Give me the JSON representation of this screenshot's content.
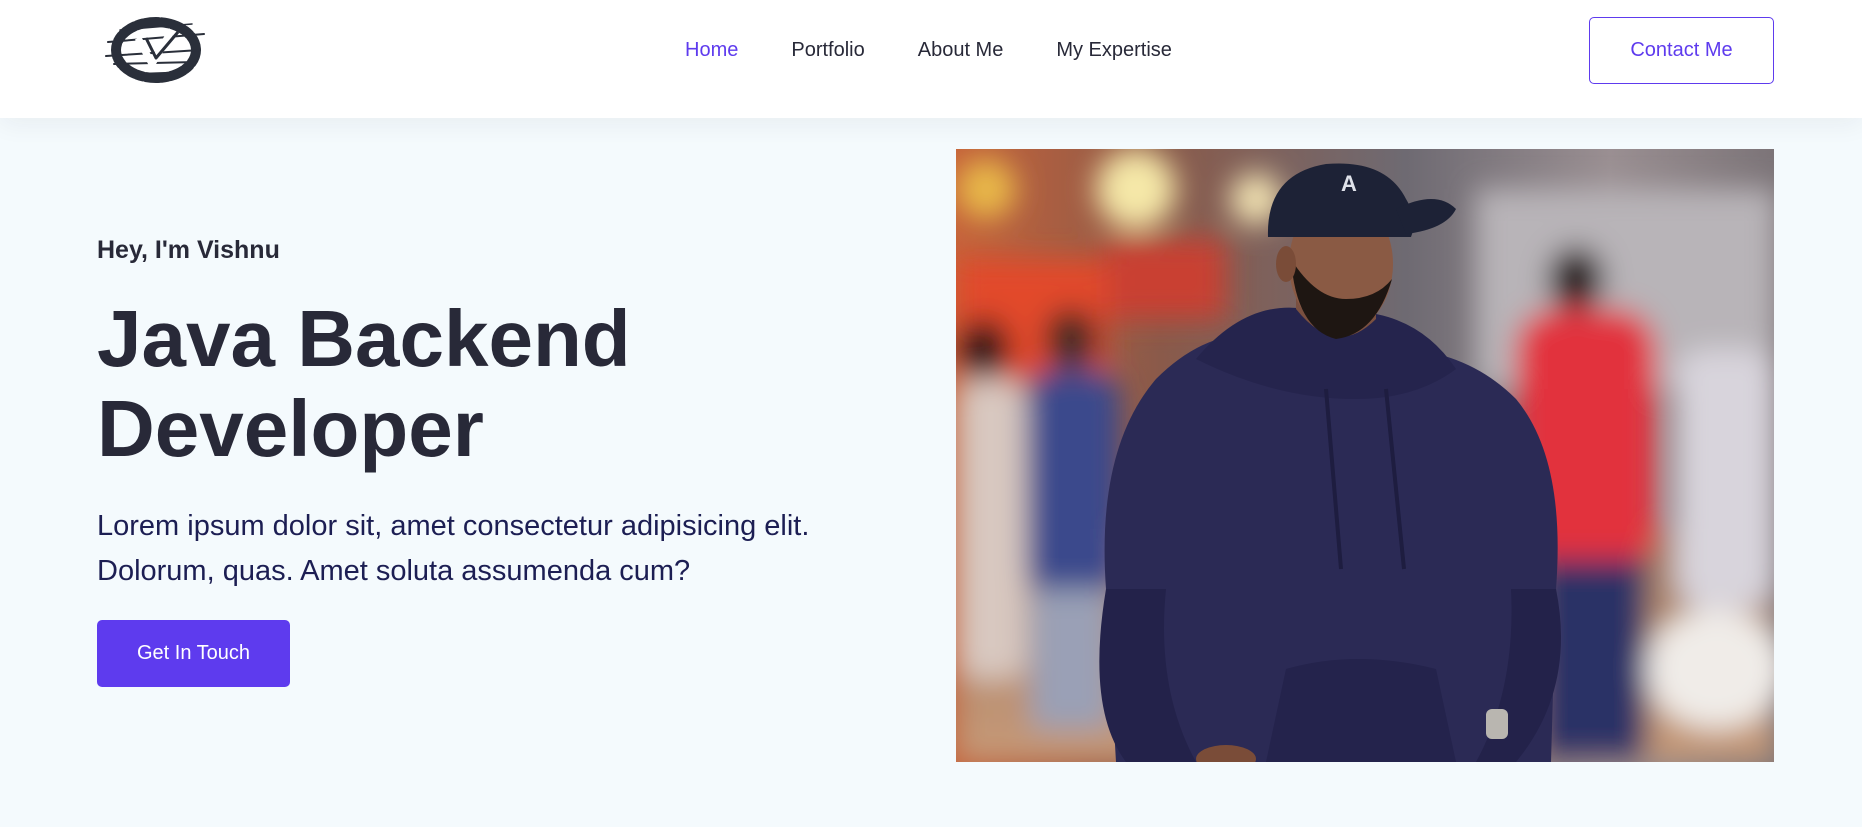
{
  "nav": {
    "logo_icon": "vv-brush-logo",
    "links": [
      {
        "label": "Home",
        "active": true
      },
      {
        "label": "Portfolio",
        "active": false
      },
      {
        "label": "About Me",
        "active": false
      },
      {
        "label": "My Expertise",
        "active": false
      }
    ],
    "contact_label": "Contact Me"
  },
  "hero": {
    "greeting": "Hey, I'm Vishnu",
    "title_line1": "Java Backend",
    "title_line2": "Developer",
    "description": "Lorem ipsum dolor sit, amet consectetur adipisicing elit. Dolorum, quas. Amet soluta assumenda cum?",
    "cta_label": "Get In Touch",
    "image_icon": "profile-photo"
  },
  "colors": {
    "accent": "#5e3bee",
    "heading": "#282938",
    "background": "#f4fafd",
    "nav_bg": "#ffffff"
  }
}
